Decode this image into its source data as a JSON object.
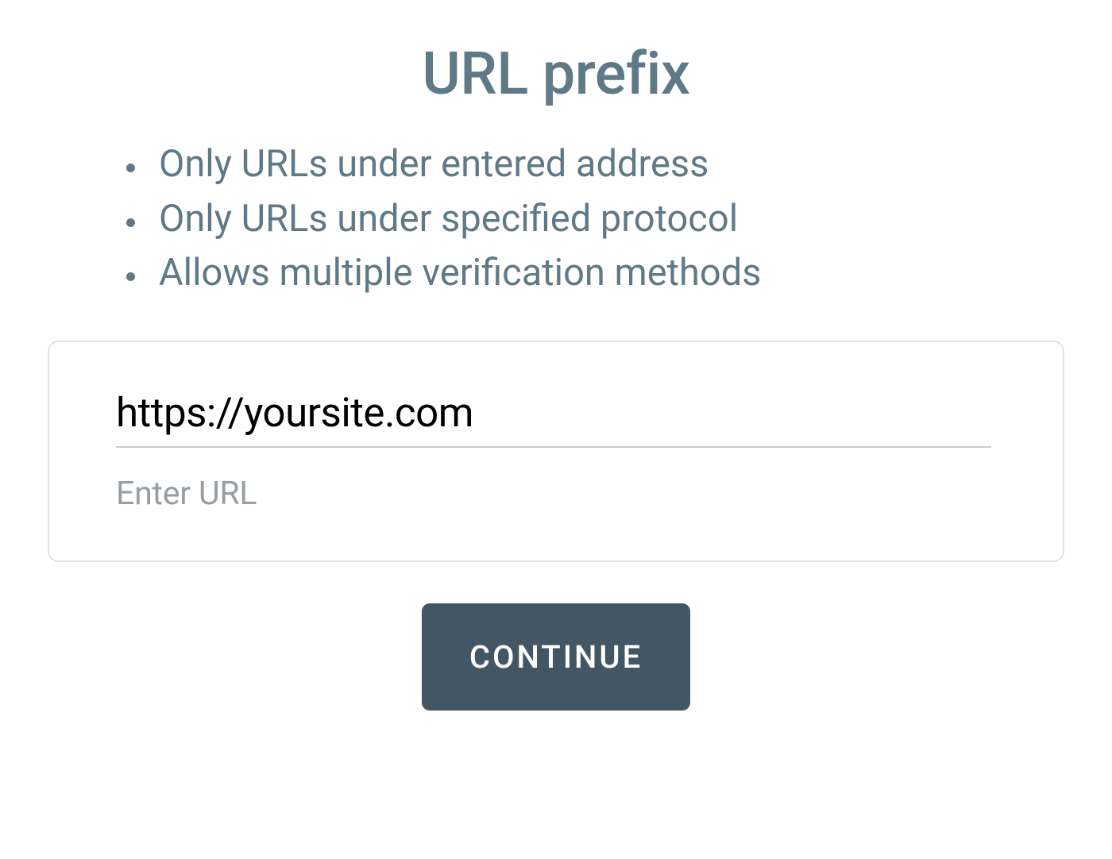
{
  "title": "URL prefix",
  "bullets": [
    "Only URLs under entered address",
    "Only URLs under specified protocol",
    "Allows multiple verification methods"
  ],
  "input": {
    "value": "https://yoursite.com",
    "helper": "Enter URL"
  },
  "button": {
    "continue_label": "CONTINUE"
  }
}
